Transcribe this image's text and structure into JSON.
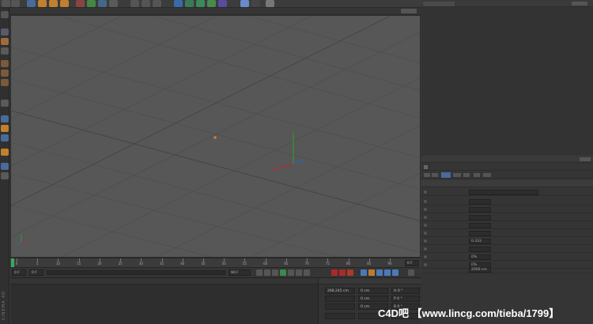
{
  "viewport": {
    "camera_label": "",
    "distance_label": ""
  },
  "timeline": {
    "ticks": [
      "0",
      "5",
      "10",
      "15",
      "20",
      "25",
      "30",
      "35",
      "40",
      "45",
      "50",
      "55",
      "60",
      "65",
      "70",
      "75",
      "80",
      "85",
      "90"
    ],
    "end_field": "0 F"
  },
  "playback": {
    "start_frame": "0 F",
    "current_frame": "0 F",
    "end_frame": "90 F"
  },
  "coordinates": {
    "rows": [
      {
        "axis": "X",
        "pos": "268.245 cm",
        "size": "0 cm",
        "rot": "H 0 °"
      },
      {
        "axis": "Y",
        "pos": "",
        "size": "0 cm",
        "rot": "P 0 °"
      },
      {
        "axis": "Z",
        "pos": "",
        "size": "0 cm",
        "rot": "B 0 °"
      }
    ]
  },
  "attributes": {
    "fields": [
      {
        "value": ""
      },
      {
        "value": ""
      },
      {
        "value": ""
      },
      {
        "value": ""
      },
      {
        "value": ""
      },
      {
        "value": ""
      },
      {
        "value": "0.333"
      },
      {
        "value": ""
      },
      {
        "value": "0%"
      },
      {
        "value": "0%"
      }
    ],
    "bottom_field": "2000 cm"
  },
  "watermark": "C4D吧 【www.lincg.com/tieba/1799】",
  "logo_text": "CINEMA 4D",
  "colors": {
    "viewport_bg": "#575757",
    "accent_orange": "#e07a2a",
    "axis_x": "#cc2222",
    "axis_y": "#22aa22",
    "axis_z": "#2266cc"
  }
}
